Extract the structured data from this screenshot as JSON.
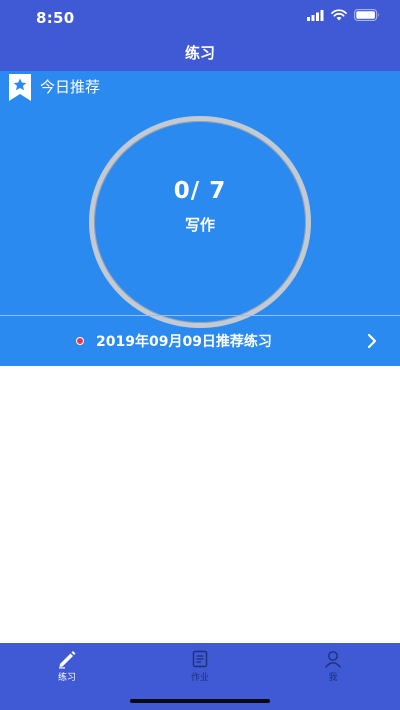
{
  "status_bar": {
    "time": "8:50"
  },
  "nav": {
    "title": "练习"
  },
  "recommend": {
    "title": "今日推荐",
    "progress_text": "0/ 7",
    "subject": "写作",
    "daily_practice": "2019年09月09日推荐练习"
  },
  "tabs": [
    {
      "label": "练习",
      "icon": "pencil-icon",
      "active": true
    },
    {
      "label": "作业",
      "icon": "notebook-icon",
      "active": false
    },
    {
      "label": "我",
      "icon": "user-icon",
      "active": false
    }
  ],
  "colors": {
    "header_bg": "#3f5ad4",
    "panel_bg": "#2a8af0",
    "ring": "#c4cad3",
    "dot": "#e8365b",
    "tab_inactive": "#1f2f7a"
  }
}
